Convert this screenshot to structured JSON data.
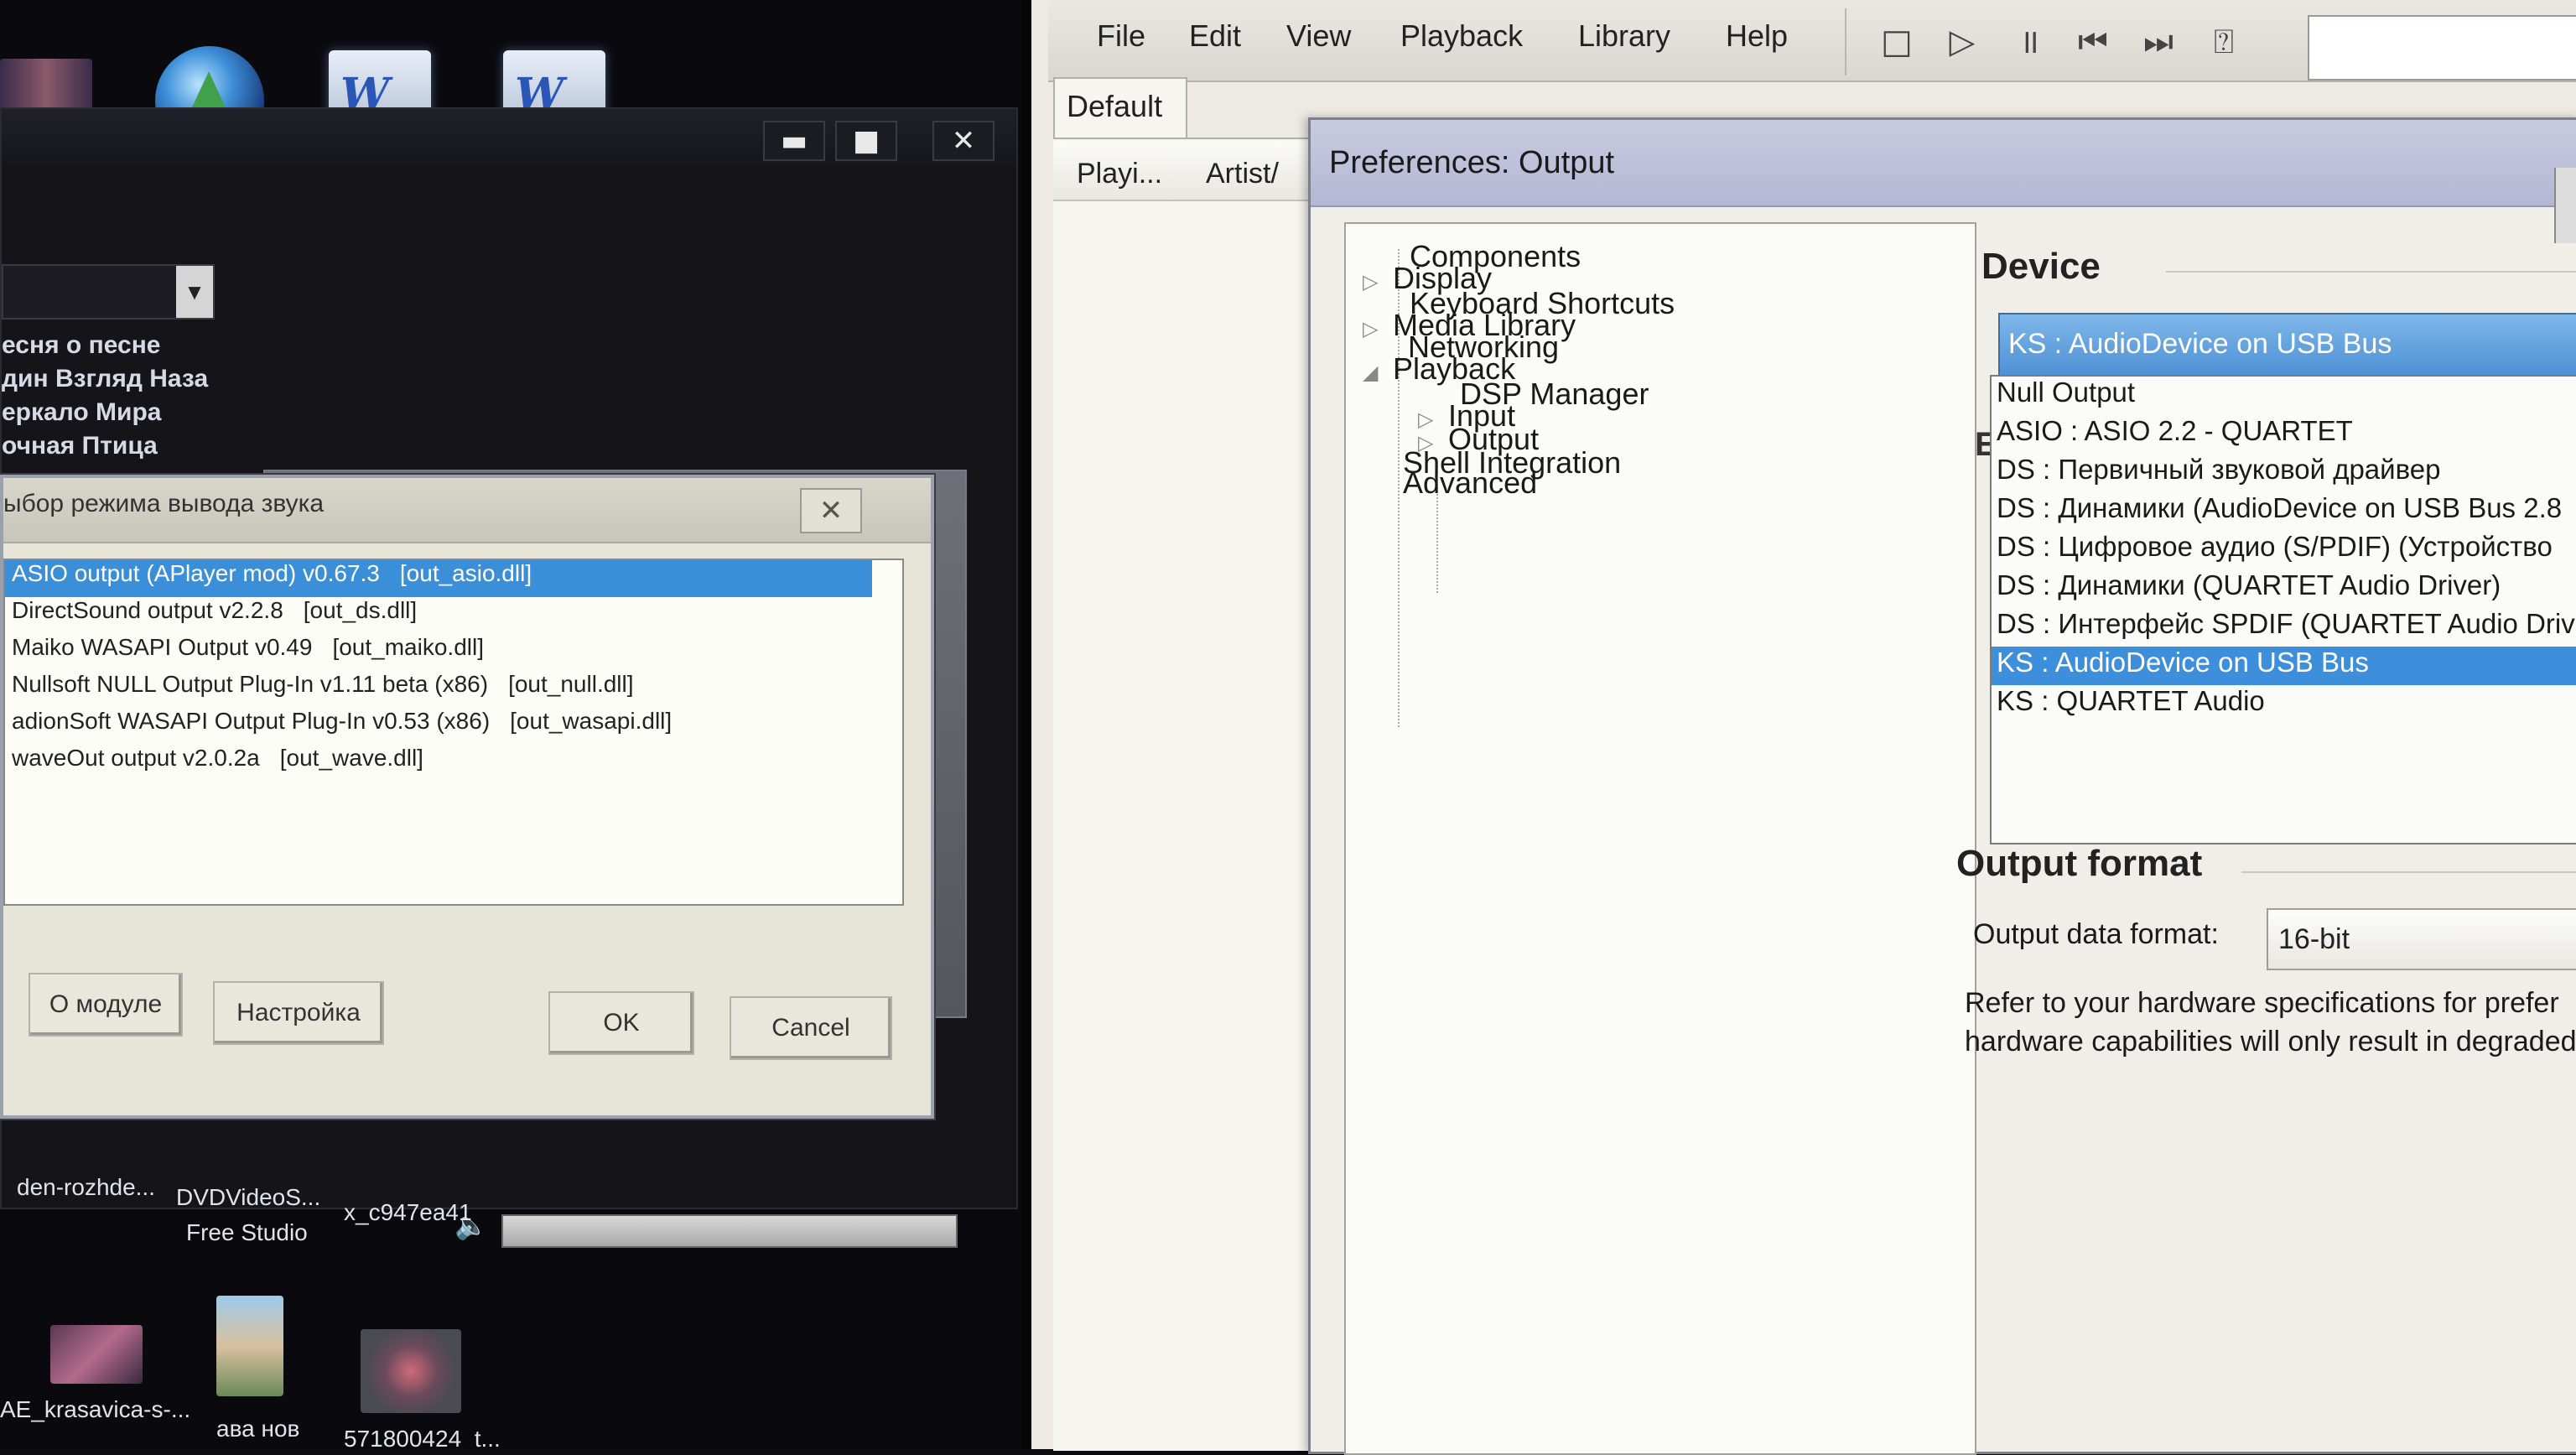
{
  "desktop": {
    "icons_bottom": [
      {
        "label": "den-rozhde..."
      },
      {
        "label": "DVDVideoS...",
        "label2": "Free Studio"
      },
      {
        "label": "x_c947ea41"
      }
    ],
    "icons_bottom2": [
      {
        "label": "AE_krasavica-s-..."
      },
      {
        "label": "ава нов"
      },
      {
        "label": "571800424_t..."
      }
    ]
  },
  "aimp": {
    "window_buttons": {
      "minimize": "▬",
      "maximize": "■",
      "close": "✕"
    },
    "combo_arrow": "▼",
    "songs": [
      "есня о песне",
      "дин Взгляд Наза",
      "еркало Мира",
      "очная Птица"
    ],
    "dialog": {
      "title": "ыбор режима вывода звука",
      "close": "✕",
      "plugins": [
        {
          "name": "ASIO output (APlayer mod) v0.67.3",
          "file": "[out_asio.dll]",
          "selected": true
        },
        {
          "name": "DirectSound output v2.2.8",
          "file": "[out_ds.dll]",
          "selected": false
        },
        {
          "name": "Maiko WASAPI Output v0.49",
          "file": "[out_maiko.dll]",
          "selected": false
        },
        {
          "name": "Nullsoft NULL Output Plug-In v1.11 beta (x86)",
          "file": "[out_null.dll]",
          "selected": false
        },
        {
          "name": "adionSoft WASAPI Output Plug-In v0.53 (x86)",
          "file": "[out_wasapi.dll]",
          "selected": false
        },
        {
          "name": "waveOut output v2.0.2a",
          "file": "[out_wave.dll]",
          "selected": false
        }
      ],
      "buttons": {
        "about": "О модуле",
        "config": "Настройка",
        "ok": "OK",
        "cancel": "Cancel"
      }
    }
  },
  "foobar": {
    "menu": [
      "File",
      "Edit",
      "View",
      "Playback",
      "Library",
      "Help"
    ],
    "toolbar_icons": [
      "stop-icon",
      "play-icon",
      "pause-icon",
      "previous-icon",
      "next-icon",
      "random-icon"
    ],
    "tab": "Default",
    "columns": [
      "Playi...",
      "Artist/"
    ],
    "preferences": {
      "title": "Preferences: Output",
      "tree": [
        {
          "label": "Components",
          "expander": ""
        },
        {
          "label": "Display",
          "expander": "▷"
        },
        {
          "label": "Keyboard Shortcuts",
          "expander": ""
        },
        {
          "label": "Media Library",
          "expander": "▷"
        },
        {
          "label": "Networking",
          "expander": ""
        },
        {
          "label": "Playback",
          "expander": "◢"
        },
        {
          "label": "DSP Manager",
          "expander": ""
        },
        {
          "label": "Input",
          "expander": "▷"
        },
        {
          "label": "Output",
          "expander": "▷"
        },
        {
          "label": "Shell Integration",
          "expander": ""
        },
        {
          "label": "Advanced",
          "expander": ""
        }
      ],
      "device": {
        "header": "Device",
        "selected": "KS : AudioDevice on USB Bus",
        "options": [
          "Null Output",
          "ASIO : ASIO 2.2 - QUARTET",
          "DS : Первичный звуковой драйвер",
          "DS : Динамики (AudioDevice on USB Bus 2.8",
          "DS : Цифровое аудио (S/PDIF) (Устройство",
          "DS : Динамики (QUARTET Audio Driver)",
          "DS : Интерфейс SPDIF (QUARTET Audio Driv",
          "KS : AudioDevice on USB Bus",
          "KS : QUARTET Audio"
        ],
        "selected_index": 7
      },
      "output_format": {
        "header": "Output format",
        "label": "Output data format:",
        "value": "16-bit",
        "note_line1": "Refer to your hardware specifications for prefer",
        "note_line2": "hardware capabilities will only result in degraded"
      },
      "hidden_letter": "E"
    }
  }
}
